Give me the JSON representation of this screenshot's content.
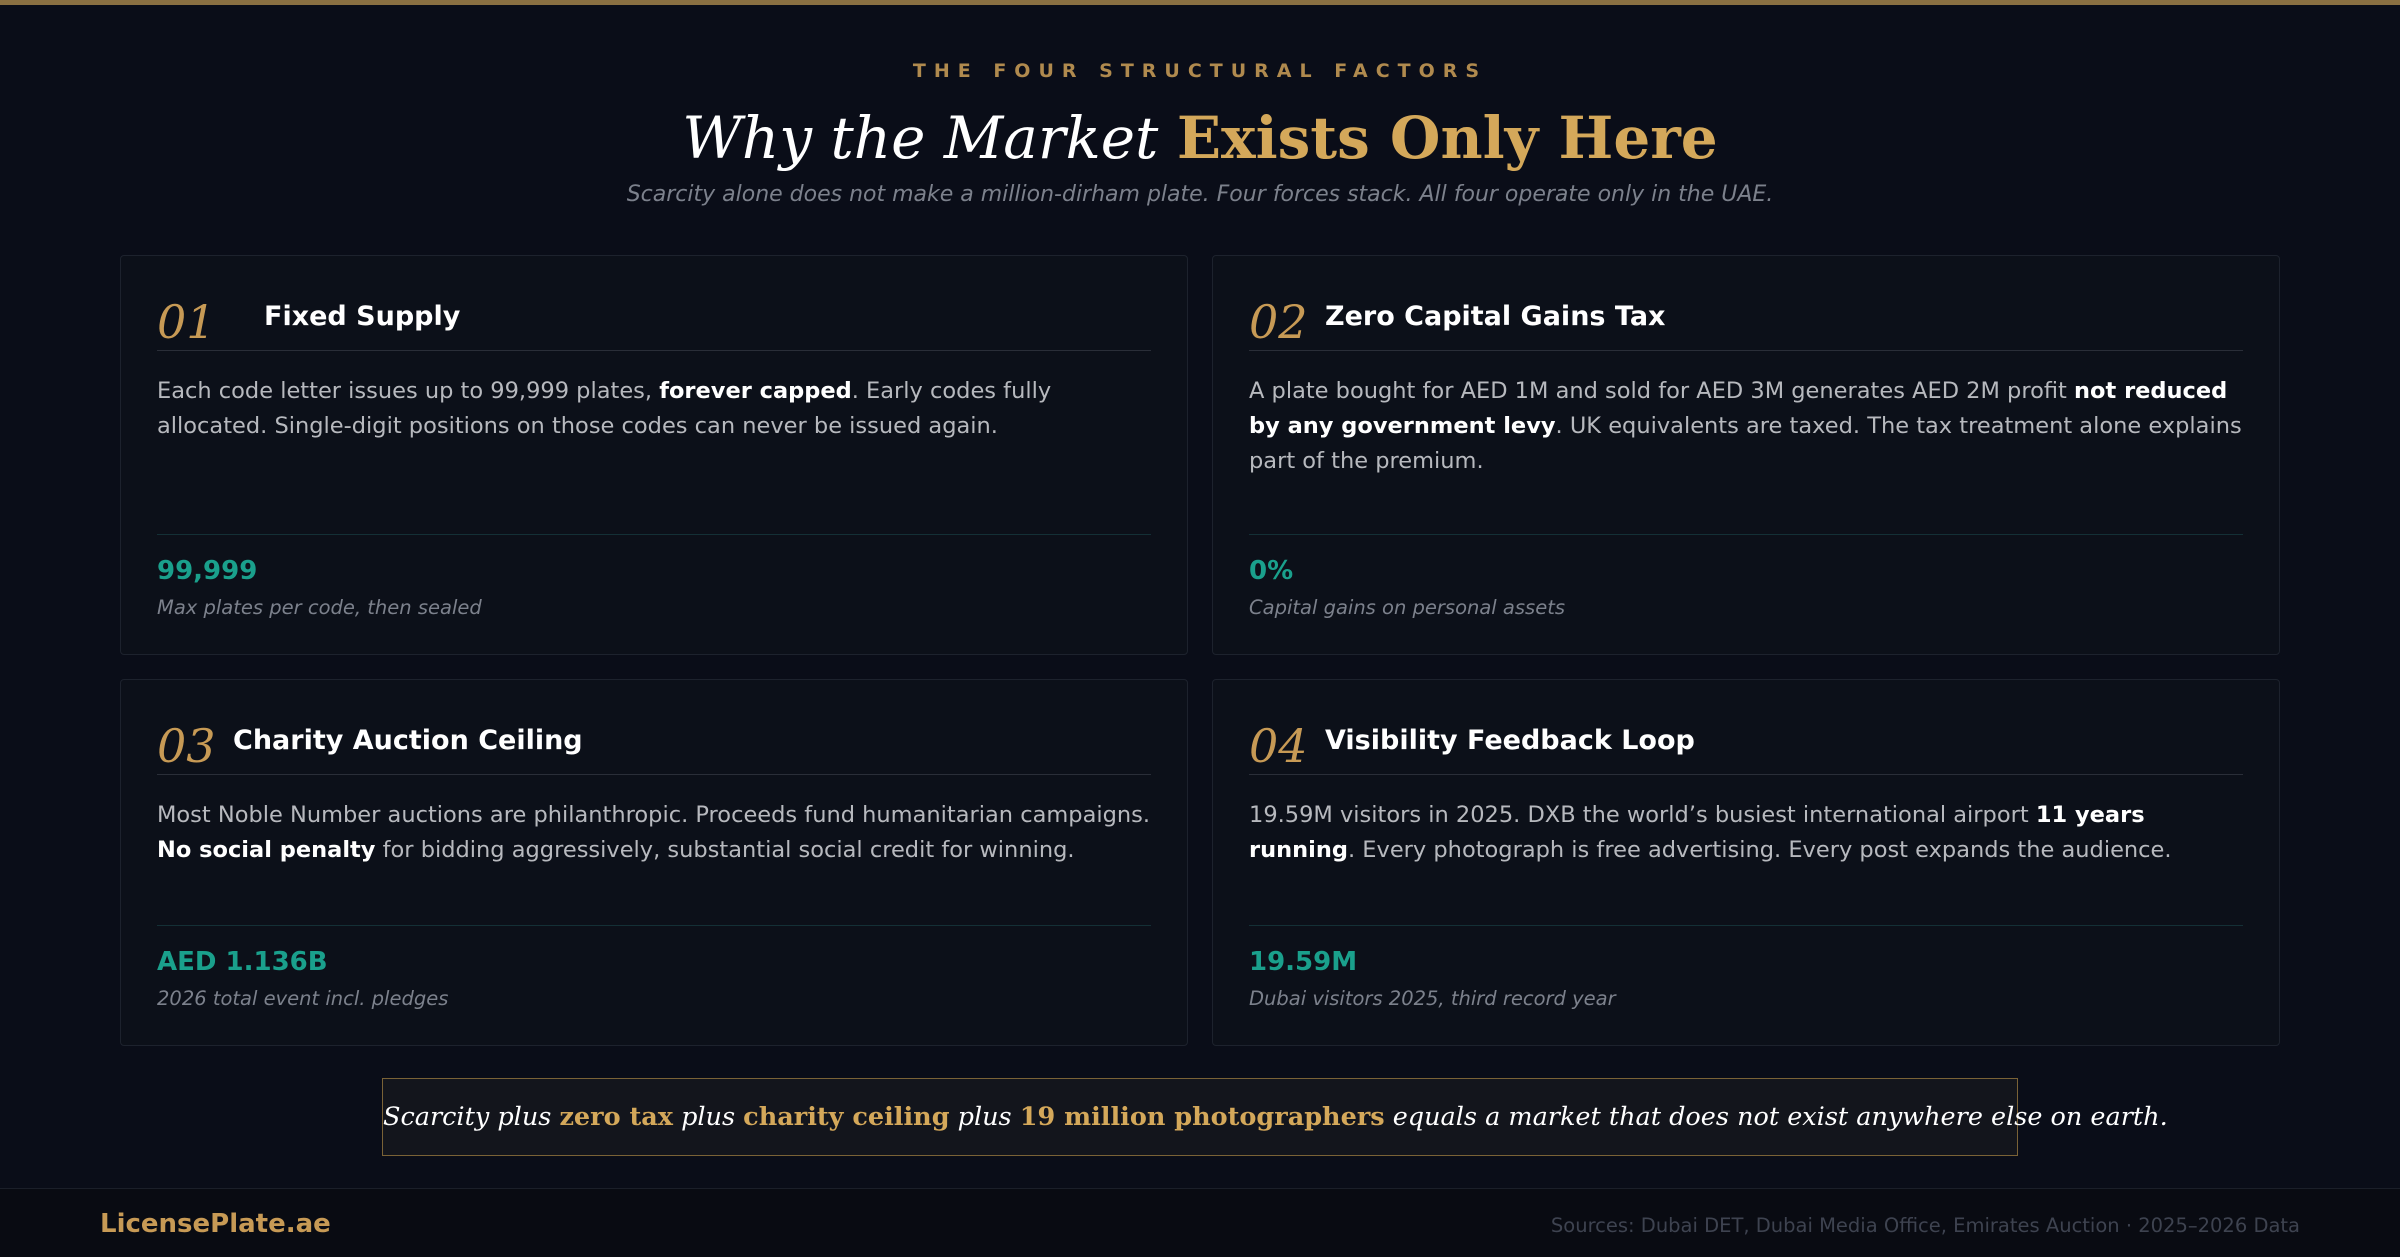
{
  "header": {
    "eyebrow": "THE FOUR STRUCTURAL FACTORS",
    "title_part1": "Why the Market",
    "title_part2": "Exists Only Here",
    "subtitle": "Scarcity alone does not make a million-dirham plate. Four forces stack. All four operate only in the UAE."
  },
  "cards": [
    {
      "number": "01",
      "title": "Fixed Supply",
      "body_pre": "Each code letter issues up to 99,999 plates, ",
      "body_bold": "forever capped",
      "body_post": ". Early codes fully allocated. Single-digit positions on those codes can never be issued again.",
      "stat": "99,999",
      "stat_label": "Max plates per code, then sealed"
    },
    {
      "number": "02",
      "title": "Zero Capital Gains Tax",
      "body_pre": "A plate bought for AED 1M and sold for AED 3M generates AED 2M profit ",
      "body_bold": "not reduced by any government levy",
      "body_post": ". UK equivalents are taxed. The tax treatment alone explains part of the premium.",
      "stat": "0%",
      "stat_label": "Capital gains on personal assets"
    },
    {
      "number": "03",
      "title": "Charity Auction Ceiling",
      "body_pre": "Most Noble Number auctions are philanthropic. Proceeds fund humanitarian campaigns. ",
      "body_bold": "No social penalty",
      "body_post": " for bidding aggressively, substantial social credit for winning.",
      "stat": "AED 1.136B",
      "stat_label": "2026 total event incl. pledges"
    },
    {
      "number": "04",
      "title": "Visibility Feedback Loop",
      "body_pre": "19.59M visitors in 2025. DXB the world’s busiest international airport ",
      "body_bold": "11 years running",
      "body_post": ". Every photograph is free advertising. Every post expands the audience.",
      "stat": "19.59M",
      "stat_label": "Dubai visitors 2025, third record year"
    }
  ],
  "quote": {
    "p1": "Scarcity plus ",
    "h1": "zero tax",
    "p2": " plus ",
    "h2": "charity ceiling",
    "p3": " plus ",
    "h3": "19 million photographers",
    "p4": " equals a market that does not exist anywhere else on earth."
  },
  "footer": {
    "brand": "LicensePlate.ae",
    "sources": "Sources: Dubai DET, Dubai Media Office, Emirates Auction · 2025–2026 Data"
  },
  "colors": {
    "background": "#0a0d18",
    "gold": "#d4a85a",
    "teal": "#1aa08c"
  }
}
